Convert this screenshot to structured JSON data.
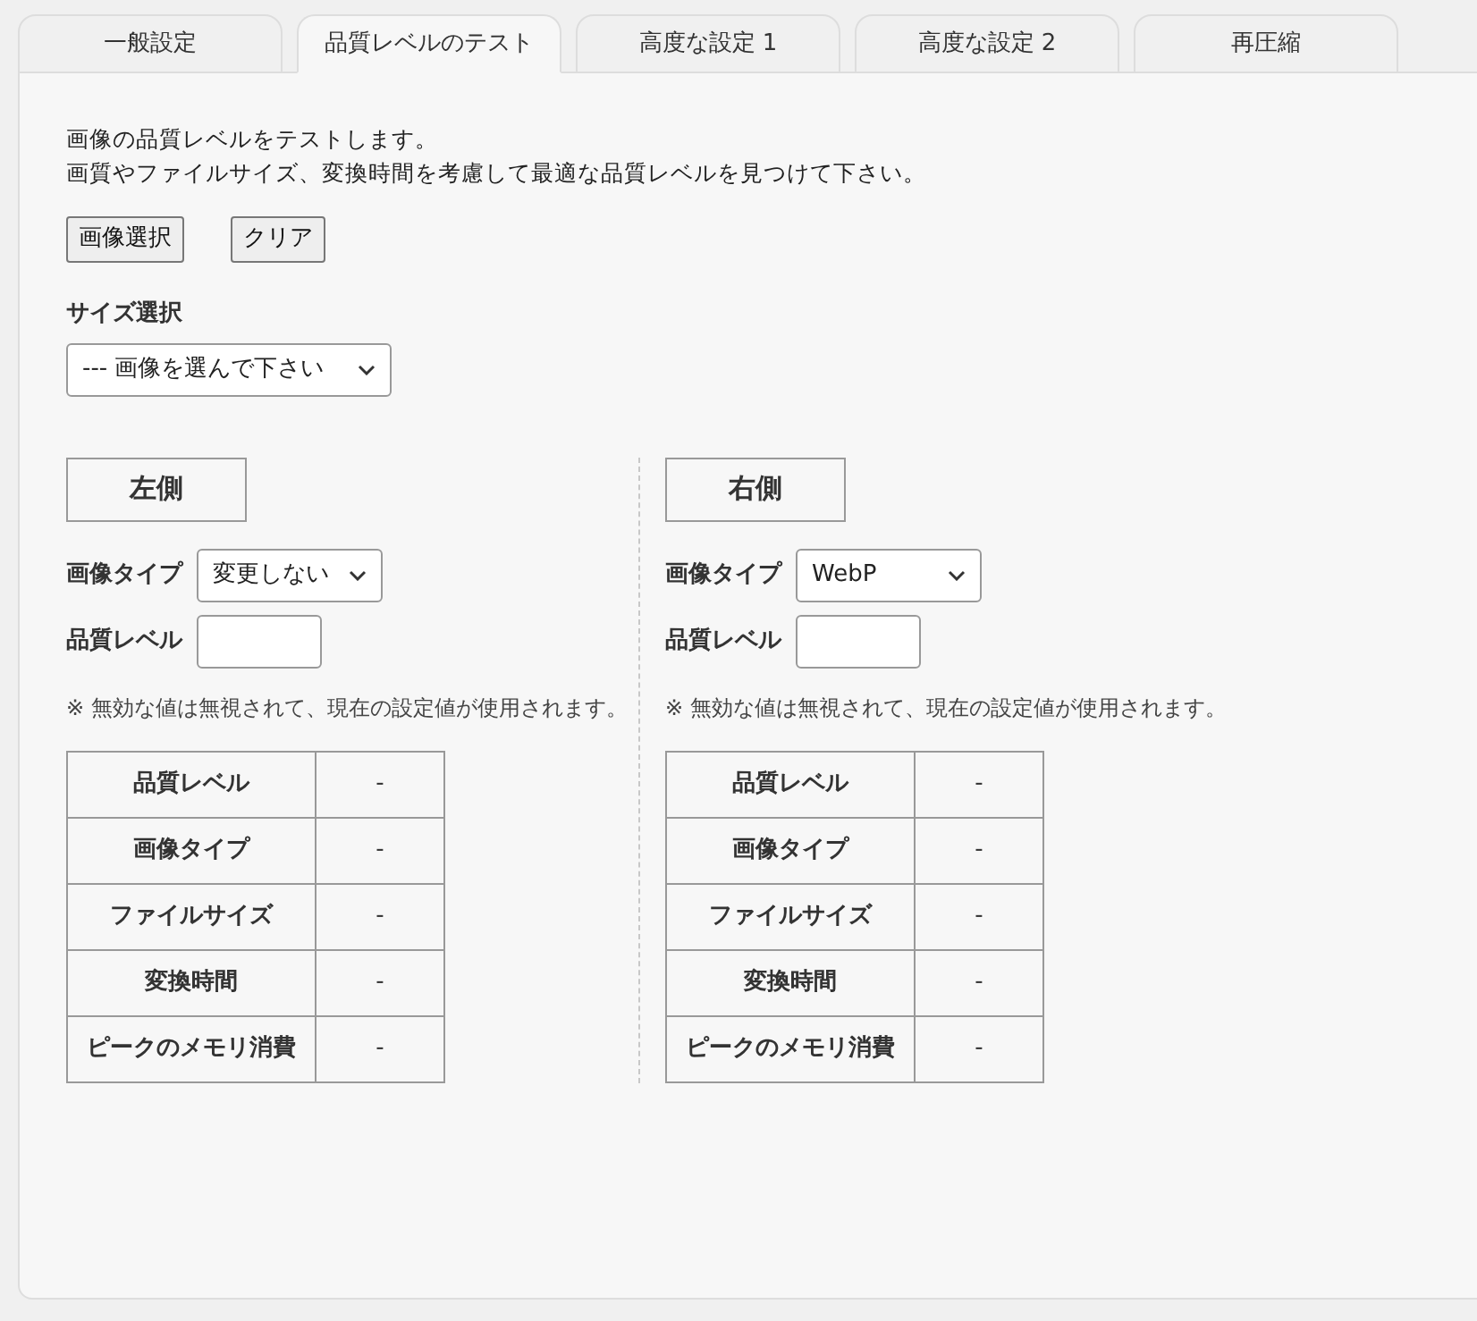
{
  "tabs": [
    {
      "label": "一般設定",
      "selected": false
    },
    {
      "label": "品質レベルのテスト",
      "selected": true
    },
    {
      "label": "高度な設定 1",
      "selected": false
    },
    {
      "label": "高度な設定 2",
      "selected": false
    },
    {
      "label": "再圧縮",
      "selected": false
    }
  ],
  "intro": [
    "画像の品質レベルをテストします。",
    "画質やファイルサイズ、変換時間を考慮して最適な品質レベルを見つけて下さい。"
  ],
  "buttons": [
    "画像選択",
    "クリア"
  ],
  "size_select": {
    "label": "サイズ選択",
    "value": "--- 画像を選んで下さい"
  },
  "sides": [
    {
      "heading": "左側",
      "image_type_label": "画像タイプ",
      "image_type_value": "変更しない",
      "quality_label": "品質レベル",
      "note": "※ 無効な値は無視されて、現在の設定値が使用されます。",
      "rows": [
        {
          "label": "品質レベル",
          "value": "-"
        },
        {
          "label": "画像タイプ",
          "value": "-"
        },
        {
          "label": "ファイルサイズ",
          "value": "-"
        },
        {
          "label": "変換時間",
          "value": "-"
        },
        {
          "label": "ピークのメモリ消費",
          "value": "-"
        }
      ]
    },
    {
      "heading": "右側",
      "image_type_label": "画像タイプ",
      "image_type_value": "WebP",
      "quality_label": "品質レベル",
      "note": "※ 無効な値は無視されて、現在の設定値が使用されます。",
      "rows": [
        {
          "label": "品質レベル",
          "value": "-"
        },
        {
          "label": "画像タイプ",
          "value": "-"
        },
        {
          "label": "ファイルサイズ",
          "value": "-"
        },
        {
          "label": "変換時間",
          "value": "-"
        },
        {
          "label": "ピークのメモリ消費",
          "value": "-"
        }
      ]
    }
  ]
}
